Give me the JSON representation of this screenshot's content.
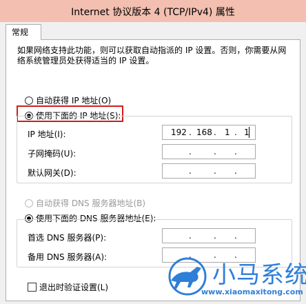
{
  "window": {
    "title": "Internet 协议版本 4 (TCP/IPv4) 属性"
  },
  "tab": {
    "label": "常规"
  },
  "description": "如果网络支持此功能，则可以获取自动指派的 IP 设置。否则，你需要从网络系统管理员处获得适当的 IP 设置。",
  "ip_section": {
    "auto_label": "自动获得 IP 地址(O)",
    "manual_label": "使用下面的 IP 地址(S):",
    "manual_selected": true,
    "fields": [
      {
        "label": "IP 地址(I):",
        "octets": [
          "192",
          "168",
          "1",
          "1"
        ]
      },
      {
        "label": "子网掩码(U):",
        "octets": [
          "",
          "",
          "",
          ""
        ]
      },
      {
        "label": "默认网关(D):",
        "octets": [
          "",
          "",
          "",
          ""
        ]
      }
    ]
  },
  "dns_section": {
    "auto_label": "自动获得 DNS 服务器地址(B)",
    "manual_label": "使用下面的 DNS 服务器地址(E):",
    "manual_selected": true,
    "fields": [
      {
        "label": "首选 DNS 服务器(P):",
        "octets": [
          "",
          "",
          "",
          ""
        ]
      },
      {
        "label": "备用 DNS 服务器(A):",
        "octets": [
          "",
          "",
          "",
          ""
        ]
      }
    ]
  },
  "validate_label": "退出时验证设置(L)",
  "watermark": {
    "brand": "小马系统",
    "url": "www.xiaomaxitong.com"
  },
  "colors": {
    "titlebar": "#f2bfb0",
    "highlight": "#d01c1c",
    "watermark": "#2f7ed8"
  }
}
